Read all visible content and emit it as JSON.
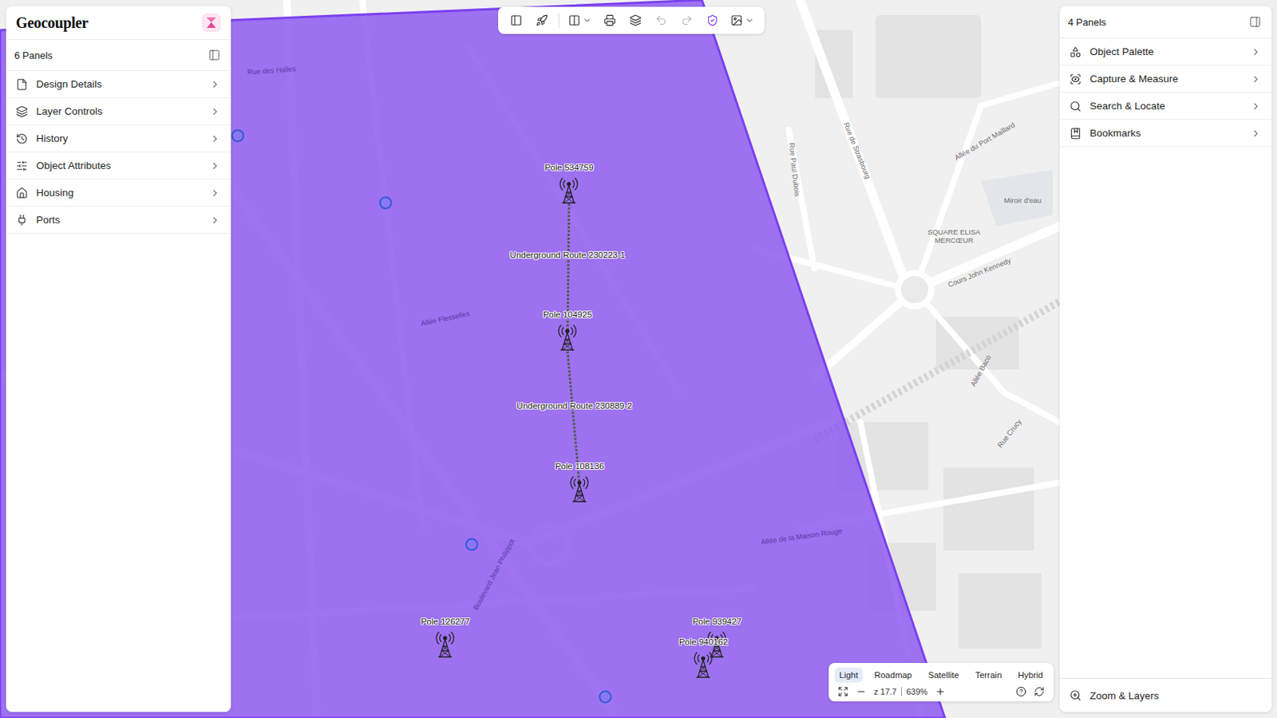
{
  "app": {
    "title": "Geocoupler"
  },
  "left_panel": {
    "header": "6 Panels",
    "items": [
      {
        "label": "Design Details"
      },
      {
        "label": "Layer Controls"
      },
      {
        "label": "History"
      },
      {
        "label": "Object Attributes"
      },
      {
        "label": "Housing"
      },
      {
        "label": "Ports"
      }
    ]
  },
  "right_panel": {
    "header": "4 Panels",
    "items": [
      {
        "label": "Object Palette"
      },
      {
        "label": "Capture & Measure"
      },
      {
        "label": "Search & Locate"
      },
      {
        "label": "Bookmarks"
      }
    ],
    "footer": "Zoom & Layers"
  },
  "toolbar": {
    "buttons": [
      {
        "kind": "panel",
        "disabled": false,
        "active": false,
        "has_menu": false
      },
      {
        "kind": "route",
        "disabled": false,
        "active": false,
        "has_menu": false
      },
      {
        "kind": "columns",
        "disabled": false,
        "active": false,
        "has_menu": true
      },
      {
        "kind": "print",
        "disabled": false,
        "active": false,
        "has_menu": false
      },
      {
        "kind": "layers",
        "disabled": false,
        "active": false,
        "has_menu": false
      },
      {
        "kind": "undo",
        "disabled": true,
        "active": false,
        "has_menu": false
      },
      {
        "kind": "redo",
        "disabled": true,
        "active": false,
        "has_menu": false
      },
      {
        "kind": "shield",
        "disabled": false,
        "active": true,
        "has_menu": false
      },
      {
        "kind": "report",
        "disabled": false,
        "active": false,
        "has_menu": true
      }
    ]
  },
  "map": {
    "poles": [
      {
        "label": "Pole 534759"
      },
      {
        "label": "Pole 104925"
      },
      {
        "label": "Pole 108136"
      },
      {
        "label": "Pole 126277"
      },
      {
        "label": "Pole 939427"
      },
      {
        "label": "Pole 940162"
      }
    ],
    "routes": [
      {
        "label": "Underground Route 230223-1"
      },
      {
        "label": "Underground Route 230889-2"
      }
    ],
    "street_labels": [
      {
        "text": "Rue de Strasbourg"
      },
      {
        "text": "Allée du Port Maillard"
      },
      {
        "text": "Rue Paul Dubois"
      },
      {
        "text": "Miroir d'eau"
      },
      {
        "text": "SQUARE ELISA MERCŒUR"
      },
      {
        "text": "Cours John Kennedy"
      },
      {
        "text": "Allée Baco"
      },
      {
        "text": "Rue Crucy"
      },
      {
        "text": "Rue des Halles"
      },
      {
        "text": "Allée Flesselles"
      },
      {
        "text": "Boulevard Jean Philippot"
      },
      {
        "text": "Allée de la Maison Rouge"
      }
    ]
  },
  "map_controls": {
    "types": [
      {
        "label": "Light",
        "selected": true
      },
      {
        "label": "Roadmap",
        "selected": false
      },
      {
        "label": "Satellite",
        "selected": false
      },
      {
        "label": "Terrain",
        "selected": false
      },
      {
        "label": "Hybrid",
        "selected": false
      }
    ],
    "zoom": "z 17.7",
    "scale": "639%"
  }
}
